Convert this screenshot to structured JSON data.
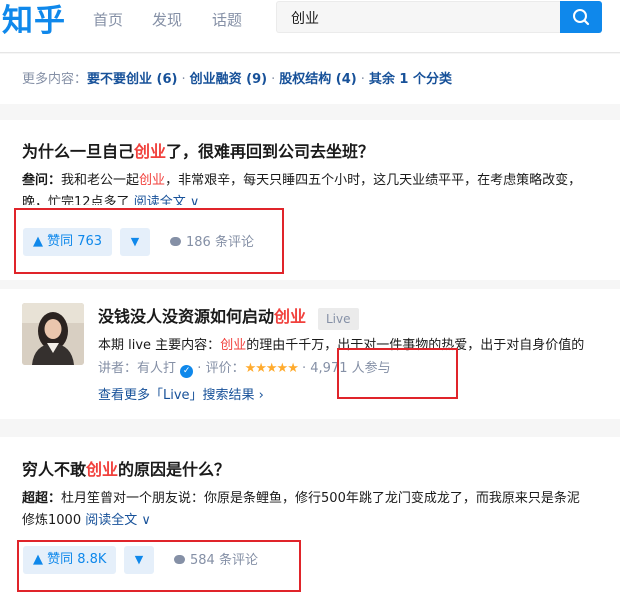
{
  "header": {
    "logo": "知乎",
    "nav": [
      "首页",
      "发现",
      "话题"
    ],
    "search_value": "创业"
  },
  "filters": {
    "label": "更多内容：",
    "items": [
      "要不要创业 (6)",
      "创业融资 (9)",
      "股权结构 (4)",
      "其余 1 个分类"
    ]
  },
  "result1": {
    "title_pre": "为什么一旦自己",
    "title_hl": "创业",
    "title_post": "了，很难再回到公司去坐班？",
    "author": "叁问",
    "colon": "：",
    "excerpt_pre": "我和老公一起",
    "excerpt_hl": "创业",
    "excerpt_post": "，非常艰辛，每天只睡四五个小时，这几天业绩平平，在考虑策略改变，",
    "excerpt_line2": "晚，忙完12点多了",
    "read_more": "阅读全文 ∨",
    "vote_label": "▲ 赞同 763",
    "vote_down": "▼",
    "comment": "186 条评论"
  },
  "live": {
    "title_pre": "没钱没人没资源如何启动",
    "title_hl": "创业",
    "badge": "Live",
    "desc_pre": "本期 live 主要内容：",
    "desc_hl": "创业",
    "desc_post": "的理由千千万，出于对一件事物的热爱，出于对自身价值的",
    "speaker_label": "讲者：",
    "speaker_name": "有人打",
    "verify_mark": "✓",
    "rating_label": " · 评价：",
    "stars": "★★★★★",
    "participants": "· 4,971 人参与",
    "more_link": "查看更多「Live」搜索结果 ›"
  },
  "result2": {
    "title_pre": "穷人不敢",
    "title_hl": "创业",
    "title_post": "的原因是什么？",
    "author": "超超",
    "colon": "：",
    "excerpt": "杜月笙曾对一个朋友说：你原是条鲤鱼，修行500年跳了龙门变成龙了，而我原来只是条泥",
    "excerpt_line2": "修炼1000 ",
    "read_more": "阅读全文 ∨",
    "vote_label": "▲ 赞同 8.8K",
    "vote_down": "▼",
    "comment": "584 条评论"
  },
  "colors": {
    "brand": "#0f88eb",
    "highlight": "#f1403c",
    "annotation": "#e0242a"
  }
}
